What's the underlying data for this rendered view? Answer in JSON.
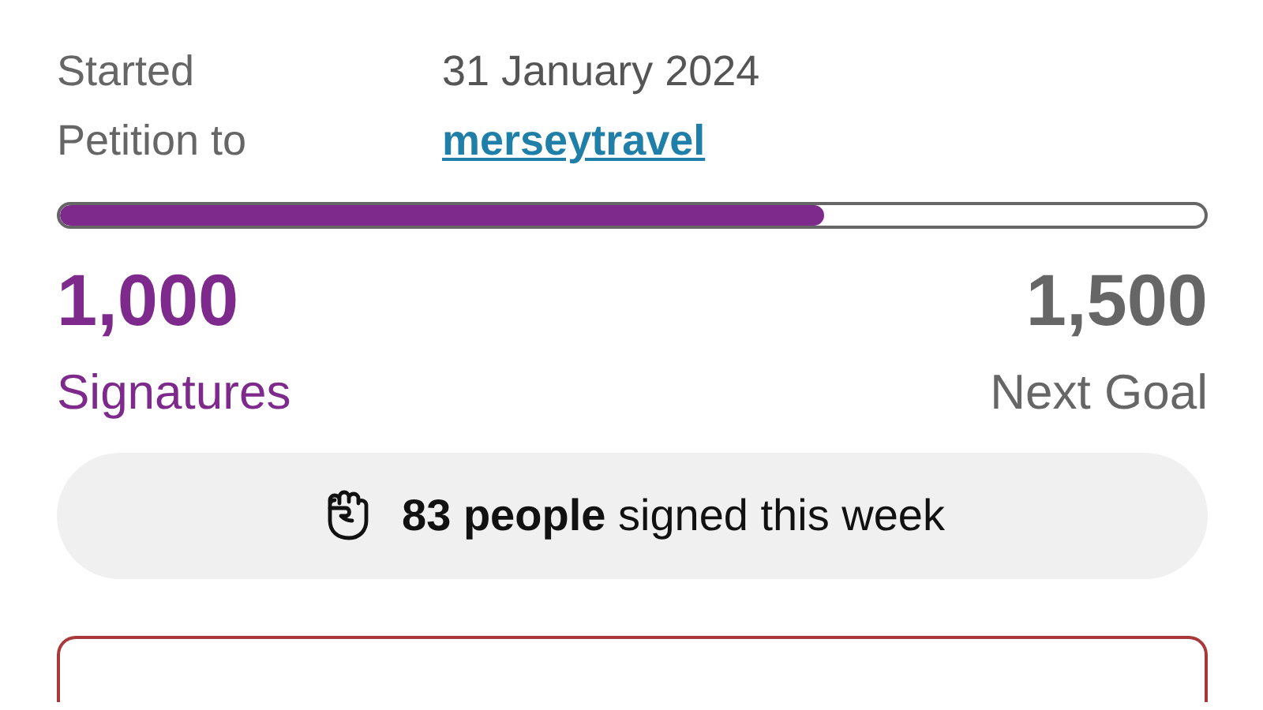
{
  "details": [
    {
      "label": "Started",
      "value": "31 January 2024",
      "kind": "text"
    },
    {
      "label": "Petition to",
      "value": "merseytravel",
      "kind": "link"
    }
  ],
  "progress": {
    "level": 0.667
  },
  "signatures": {
    "count": "1,000",
    "label": "Signatures"
  },
  "goal": {
    "count": "1,500",
    "label": "Next Goal"
  },
  "weekly": {
    "text": "**83 people** signed this week"
  }
}
